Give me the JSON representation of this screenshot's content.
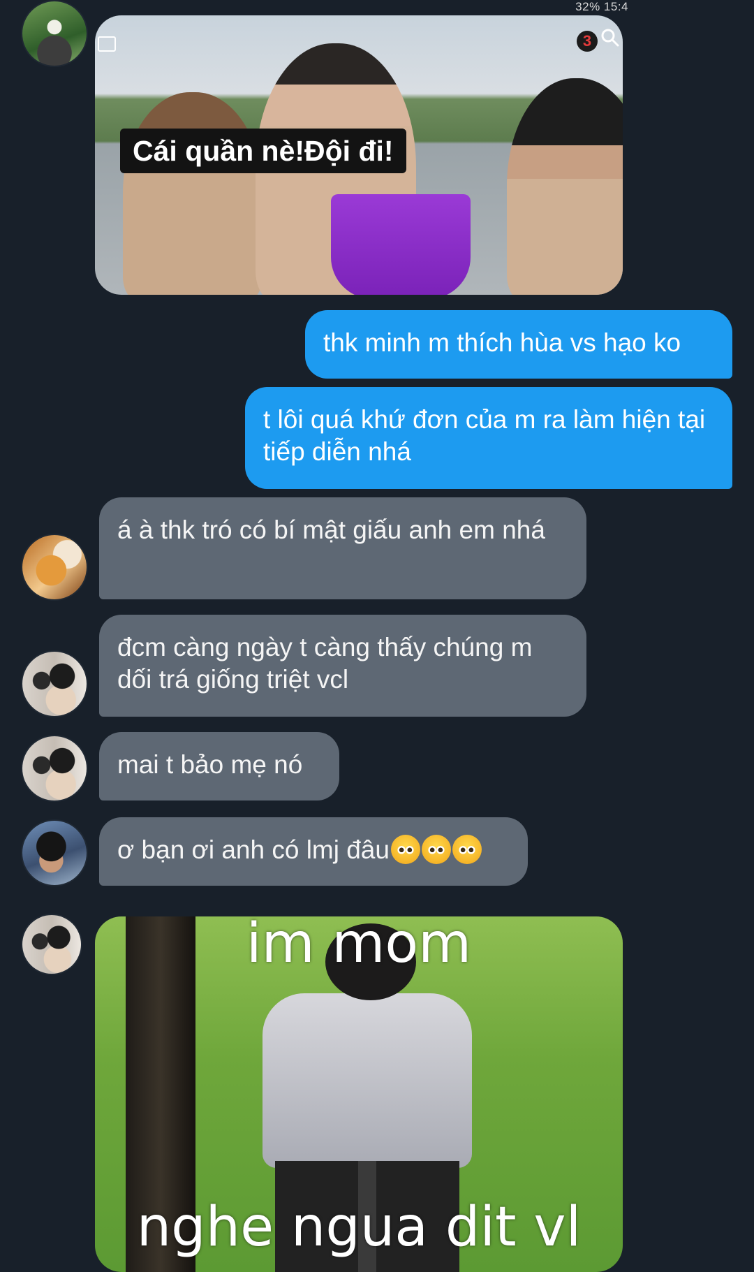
{
  "status_bar": {
    "text": "32% 15:4"
  },
  "messages": [
    {
      "type": "image",
      "side": "received",
      "caption": "Cái quần nè!Đội đi!"
    },
    {
      "type": "text",
      "side": "sent",
      "text": "thk minh m thích hùa vs hạo ko"
    },
    {
      "type": "text",
      "side": "sent",
      "text": "t lôi quá khứ đơn của m ra làm hiện tại tiếp diễn nhá"
    },
    {
      "type": "text",
      "side": "received",
      "text": "á à thk tró có bí mật giấu anh em nhá"
    },
    {
      "type": "text",
      "side": "received",
      "text": "đcm càng ngày t càng thấy chúng m dối trá giống triệt vcl"
    },
    {
      "type": "text",
      "side": "received",
      "text": "mai t bảo mẹ nó"
    },
    {
      "type": "text",
      "side": "received",
      "text": "ơ bạn ơi anh có lmj đâu",
      "emoji": [
        "pleading-face-emoji",
        "pleading-face-emoji",
        "pleading-face-emoji"
      ]
    },
    {
      "type": "image",
      "side": "received",
      "caption_top": "im mom",
      "caption_bottom": "nghe ngua dit vl"
    }
  ],
  "colors": {
    "background": "#18202a",
    "sent_bubble": "#1d9bf0",
    "received_bubble": "#5e6874"
  }
}
